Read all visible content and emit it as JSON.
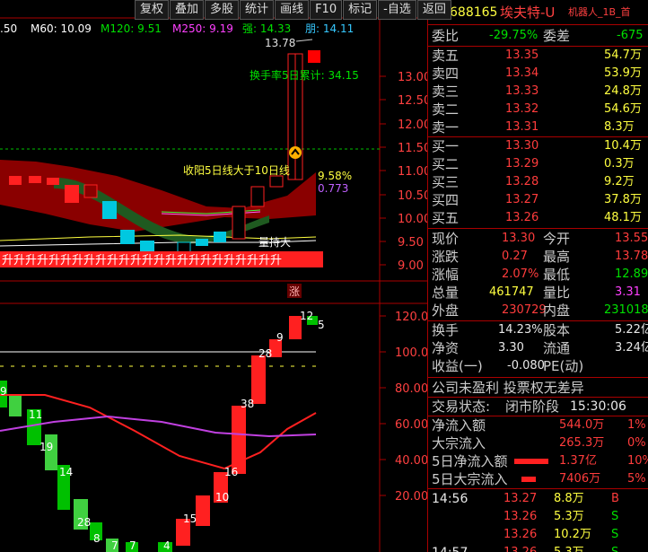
{
  "toolbar": {
    "items": [
      "复权",
      "叠加",
      "多股",
      "统计",
      "画线",
      "F10",
      "标记",
      "-自选",
      "返回"
    ]
  },
  "ma": {
    "ma5": ".50",
    "ma60": "M60: 10.09",
    "ma120": "M120: 9.51",
    "ma250": "M250: 9.19",
    "qiang": "强: 14.33",
    "bang": "朋: 14.11"
  },
  "chart_labels": {
    "high": "13.78",
    "turnover": "换手率5日累计: 34.15",
    "signal": "收阳5日线大于10日线",
    "pct1": "9.58%",
    "pct2": "0.773",
    "volume_label": "量持大",
    "zhang": "涨",
    "tiles": "升"
  },
  "axis": {
    "upper": [
      "13.00",
      "12.50",
      "12.00",
      "11.50",
      "11.00",
      "10.50",
      "10.00",
      "9.50",
      "9.00"
    ],
    "lower": [
      "120.0",
      "100.0",
      "80.00",
      "60.00",
      "40.00",
      "20.00"
    ]
  },
  "lower_labels": [
    "9",
    "11",
    "19",
    "14",
    "28",
    "8",
    "7",
    "7",
    "4",
    "15",
    "10",
    "16",
    "38",
    "28",
    "9",
    "12",
    "5"
  ],
  "header": {
    "code": "688165",
    "name": "埃夫特-U",
    "tag": "KR",
    "sub": "机器人_1B_首"
  },
  "weibi": {
    "label": "委比",
    "pct": "-29.75%",
    "label2": "委差",
    "value": "-675"
  },
  "sell": [
    {
      "l": "卖五",
      "p": "13.35",
      "v": "54.7万"
    },
    {
      "l": "卖四",
      "p": "13.34",
      "v": "53.9万"
    },
    {
      "l": "卖三",
      "p": "13.33",
      "v": "24.8万"
    },
    {
      "l": "卖二",
      "p": "13.32",
      "v": "54.6万"
    },
    {
      "l": "卖一",
      "p": "13.31",
      "v": "8.3万"
    }
  ],
  "buy": [
    {
      "l": "买一",
      "p": "13.30",
      "v": "10.4万"
    },
    {
      "l": "买二",
      "p": "13.29",
      "v": "0.3万"
    },
    {
      "l": "买三",
      "p": "13.28",
      "v": "9.2万"
    },
    {
      "l": "买四",
      "p": "13.27",
      "v": "37.8万"
    },
    {
      "l": "买五",
      "p": "13.26",
      "v": "48.1万"
    }
  ],
  "quote": [
    {
      "l1": "现价",
      "v1": "13.30",
      "l2": "今开",
      "v2": "13.55",
      "c1": "red",
      "c2": "red"
    },
    {
      "l1": "涨跌",
      "v1": "0.27",
      "l2": "最高",
      "v2": "13.78",
      "c1": "red",
      "c2": "red"
    },
    {
      "l1": "涨幅",
      "v1": "2.07%",
      "l2": "最低",
      "v2": "12.89",
      "c1": "red",
      "c2": "green"
    },
    {
      "l1": "总量",
      "v1": "461747",
      "l2": "量比",
      "v2": "3.31",
      "c1": "yellow",
      "c2": "mag"
    },
    {
      "l1": "外盘",
      "v1": "230729",
      "l2": "内盘",
      "v2": "231018",
      "c1": "red",
      "c2": "green"
    }
  ],
  "fund": [
    {
      "l1": "换手",
      "v1": "14.23%",
      "l2": "股本",
      "v2": "5.22亿"
    },
    {
      "l1": "净资",
      "v1": "3.30",
      "l2": "流通",
      "v2": "3.24亿"
    },
    {
      "l1": "收益(一)",
      "v1": "-0.080",
      "l2": "PE(动)",
      "v2": ""
    }
  ],
  "notice": "公司未盈利 投票权无差异",
  "status": {
    "label": "交易状态:",
    "value": "闭市阶段",
    "time": "15:30:06"
  },
  "flow": [
    {
      "l": "净流入额",
      "v": "544.0万",
      "p": "1%",
      "bar": 0
    },
    {
      "l": "大宗流入",
      "v": "265.3万",
      "p": "0%",
      "bar": 0
    },
    {
      "l": "5日净流入额",
      "v": "1.37亿",
      "p": "10%",
      "bar": 38
    },
    {
      "l": "5日大宗流入",
      "v": "7406万",
      "p": "5%",
      "bar": 16
    }
  ],
  "ticks": [
    {
      "t": "14:56",
      "p": "13.27",
      "v": "8.8万",
      "s": "B",
      "c": "red"
    },
    {
      "t": "",
      "p": "13.26",
      "v": "5.3万",
      "s": "S",
      "c": "green"
    },
    {
      "t": "",
      "p": "13.26",
      "v": "10.2万",
      "s": "S",
      "c": "green"
    },
    {
      "t": "14:57",
      "p": "13.26",
      "v": "5.3万",
      "s": "S",
      "c": "green"
    }
  ]
}
